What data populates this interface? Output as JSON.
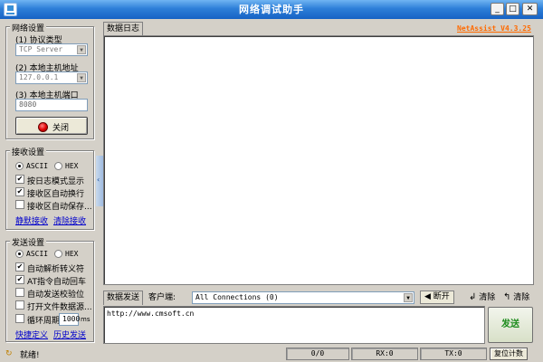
{
  "window": {
    "title": "网络调试助手",
    "min_glyph": "_",
    "max_glyph": "□",
    "close_glyph": "✕"
  },
  "net_settings": {
    "title": "网络设置",
    "protocol_label": "(1) 协议类型",
    "protocol_value": "TCP Server",
    "host_label": "(2) 本地主机地址",
    "host_value": "127.0.0.1",
    "port_label": "(3) 本地主机端口",
    "port_value": "8080",
    "toggle_label": "关闭"
  },
  "recv_settings": {
    "title": "接收设置",
    "opt_ascii": "ASCII",
    "opt_hex": "HEX",
    "chk_log_mode": "按日志模式显示",
    "chk_auto_wrap": "接收区自动换行",
    "chk_auto_save": "接收区自动保存...",
    "link_silent": "静默接收",
    "link_clear": "清除接收",
    "collapse_glyph": "‹"
  },
  "send_settings": {
    "title": "发送设置",
    "opt_ascii": "ASCII",
    "opt_hex": "HEX",
    "chk_auto_escape": "自动解析转义符",
    "chk_at_cmd": "AT指令自动回车",
    "chk_checksum": "自动发送校验位",
    "chk_open_file": "打开文件数据源...",
    "chk_loop": "循环周期",
    "loop_value": "1000",
    "loop_unit": "ms",
    "link_shortcut": "快捷定义",
    "link_history": "历史发送"
  },
  "recv_tab": "数据日志",
  "version": "NetAssist V4.3.25",
  "send_toolbar": {
    "tab": "数据发送",
    "client_label": "客户端:",
    "client_value": "All Connections (0)",
    "disconnect": "断开",
    "clear1": "清除",
    "clear2": "清除"
  },
  "send_text": "http://www.cmsoft.cn",
  "send_button": "发送",
  "status": {
    "text": "就绪!",
    "counter": "0/0",
    "rx": "RX:0",
    "tx": "TX:0",
    "reset": "复位计数"
  }
}
